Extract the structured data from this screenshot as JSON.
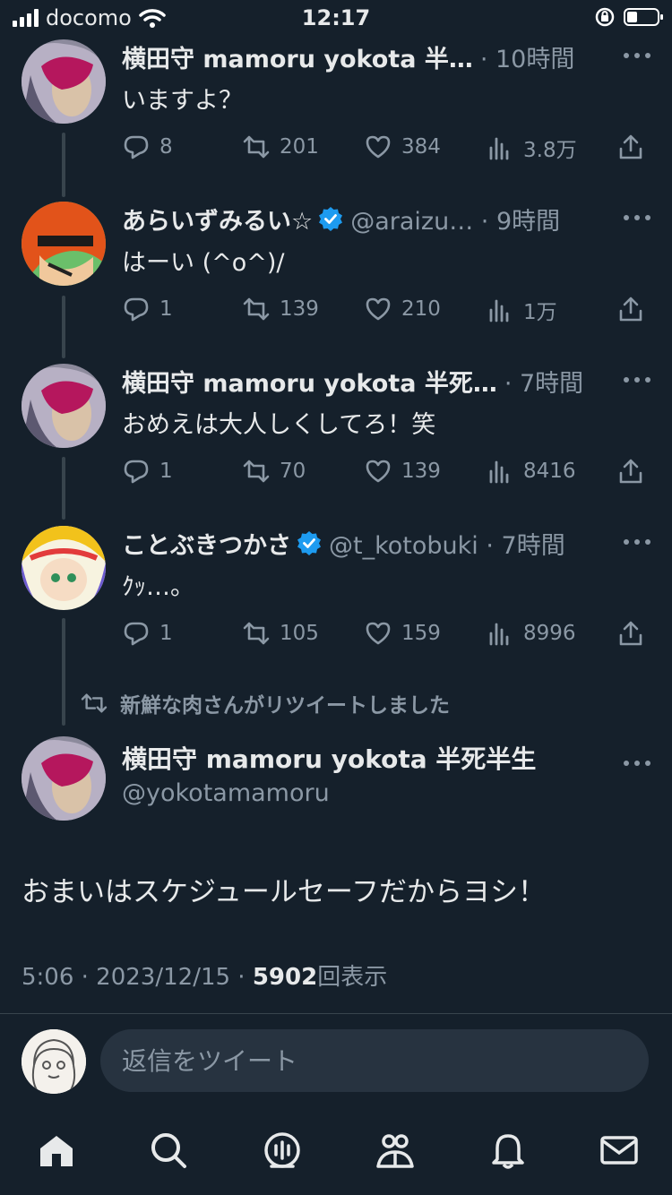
{
  "status_bar": {
    "carrier": "docomo",
    "time": "12:17",
    "battery_level": 0.35
  },
  "thread": [
    {
      "name": "横田守 mamoru yokota 半…",
      "verified": false,
      "meta": "· 10時間",
      "text": "いますよ？",
      "replies": "8",
      "retweets": "201",
      "likes": "384",
      "views": "3.8万"
    },
    {
      "name": "あらいずみるい☆",
      "verified": true,
      "meta": "@araizu… · 9時間",
      "text": "はーい (^o^)/",
      "replies": "1",
      "retweets": "139",
      "likes": "210",
      "views": "1万"
    },
    {
      "name": "横田守 mamoru yokota 半死…",
      "verified": false,
      "meta": "· 7時間",
      "text": "おめえは大人しくしてろ！笑",
      "replies": "1",
      "retweets": "70",
      "likes": "139",
      "views": "8416"
    },
    {
      "name": "ことぶきつかさ",
      "verified": true,
      "meta": "@t_kotobuki · 7時間",
      "text": "ｸｯ…。",
      "replies": "1",
      "retweets": "105",
      "likes": "159",
      "views": "8996"
    }
  ],
  "retweet_banner": "新鮮な肉さんがリツイートしました",
  "main_tweet": {
    "name": "横田守 mamoru yokota 半死半生",
    "handle": "@yokotamamoru",
    "text": "おまいはスケジュールセーフだからヨシ！",
    "timestamp": "5:06 · 2023/12/15 ·",
    "views_count": "5902",
    "views_label": "回表示"
  },
  "reply": {
    "placeholder": "返信をツイート"
  },
  "tabs": [
    "home-icon",
    "search-icon",
    "spaces-icon",
    "communities-icon",
    "notifications-icon",
    "messages-icon"
  ],
  "colors": {
    "background": "#15202b",
    "accent": "#1d9bf0",
    "muted": "#8b98a5"
  }
}
